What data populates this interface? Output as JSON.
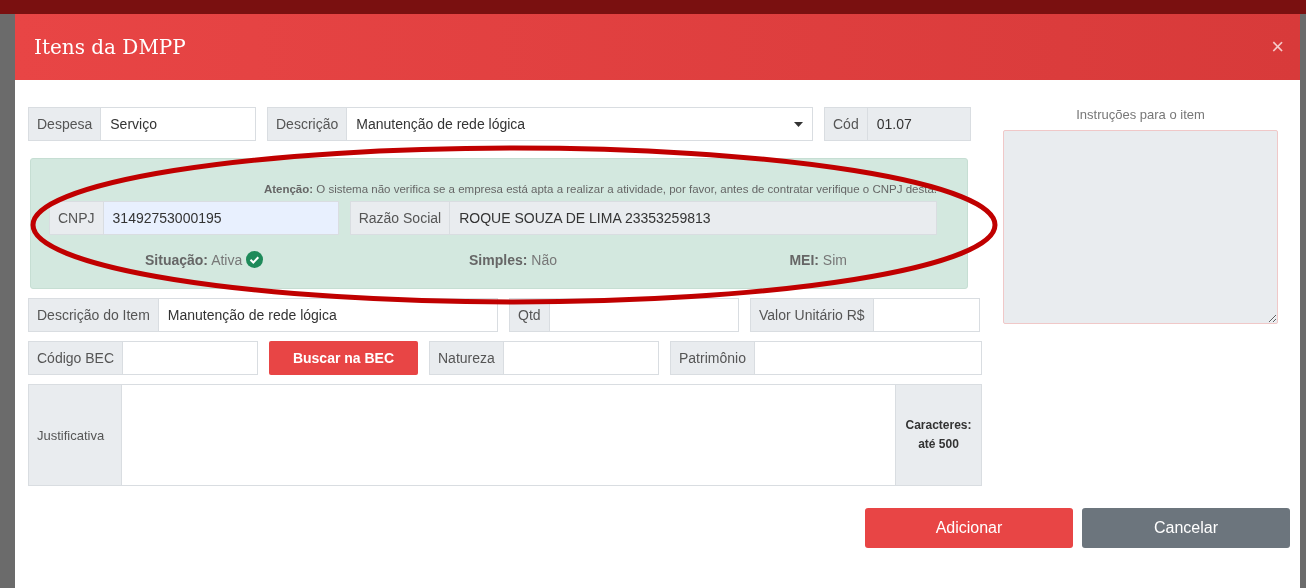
{
  "dialog": {
    "title": "Itens da DMPP",
    "close": "×"
  },
  "expense": {
    "label": "Despesa",
    "value": "Serviço"
  },
  "description": {
    "label": "Descrição",
    "value": "Manutenção de rede lógica"
  },
  "code": {
    "label": "Cód",
    "value": "01.07",
    "readonly": true
  },
  "company": {
    "notice": "**Atenção:** O sistema não verifica se a empresa está apta a realizar a atividade, por favor, antes de contratar verifique o CNPJ desta.",
    "cnpj": {
      "label": "CNPJ",
      "value": "31492753000195"
    },
    "name": {
      "label": "Razão Social",
      "value": "ROQUE SOUZA DE LIMA 23353259813",
      "readonly": true
    },
    "statuses": [
      {
        "text": "**Situação:** Ativa",
        "verified": true
      },
      {
        "text": "**Simples:** Não"
      },
      {
        "text": "**MEI:** Sim"
      }
    ],
    "highlighted": true
  },
  "item_fields": [
    {
      "label": "Descrição do Item",
      "value": "Manutenção de rede lógica"
    },
    {
      "label": "Qtd"
    },
    {
      "label": "Valor Unitário R$"
    }
  ],
  "bec_code": {
    "label": "Código BEC"
  },
  "search_button": "Buscar na BEC",
  "nature": {
    "label": "Natureza"
  },
  "asset": {
    "label": "Patrimônio"
  },
  "justification": {
    "label": "Justificativa",
    "limit": "Caracteres: até 500"
  },
  "instructions": {
    "label": "Instruções para o item"
  },
  "buttons": [
    {
      "label": "Adicionar",
      "kind": "primary"
    },
    {
      "label": "Cancelar",
      "kind": "secondary"
    }
  ]
}
